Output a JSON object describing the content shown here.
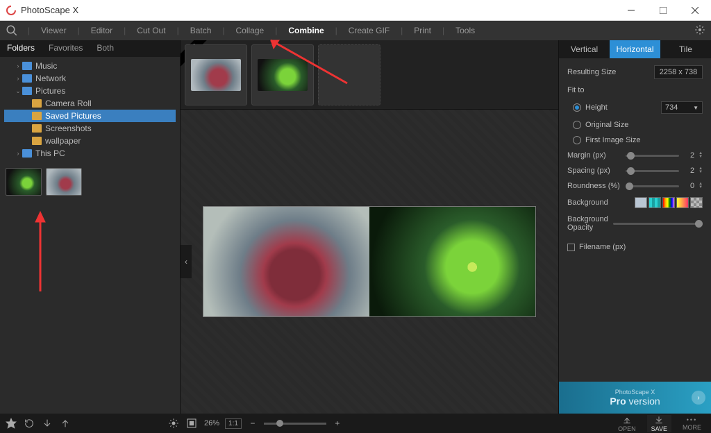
{
  "titlebar": {
    "app_name": "PhotoScape X"
  },
  "nav": {
    "items": [
      "Viewer",
      "Editor",
      "Cut Out",
      "Batch",
      "Collage",
      "Combine",
      "Create GIF",
      "Print",
      "Tools"
    ],
    "active_index": 5
  },
  "folder_tabs": {
    "items": [
      "Folders",
      "Favorites",
      "Both"
    ],
    "active_index": 0
  },
  "tree": {
    "rows": [
      {
        "label": "Music",
        "indent": 1,
        "icon": "drive",
        "arrow": "›"
      },
      {
        "label": "Network",
        "indent": 1,
        "icon": "drive",
        "arrow": "›"
      },
      {
        "label": "Pictures",
        "indent": 1,
        "icon": "drive",
        "arrow": "⌄"
      },
      {
        "label": "Camera Roll",
        "indent": 2,
        "icon": "folder",
        "arrow": ""
      },
      {
        "label": "Saved Pictures",
        "indent": 2,
        "icon": "folder",
        "arrow": "",
        "selected": true
      },
      {
        "label": "Screenshots",
        "indent": 2,
        "icon": "folder",
        "arrow": ""
      },
      {
        "label": "wallpaper",
        "indent": 2,
        "icon": "folder",
        "arrow": ""
      },
      {
        "label": "This PC",
        "indent": 1,
        "icon": "drive",
        "arrow": "›"
      }
    ]
  },
  "orient_tabs": {
    "items": [
      "Vertical",
      "Horizontal",
      "Tile"
    ],
    "active_index": 1
  },
  "panel": {
    "resulting_size_label": "Resulting Size",
    "resulting_size_value": "2258 x 738",
    "fit_to_label": "Fit to",
    "fit_to_options": [
      {
        "label": "Height",
        "checked": true,
        "value": "734"
      },
      {
        "label": "Original Size",
        "checked": false
      },
      {
        "label": "First Image Size",
        "checked": false
      }
    ],
    "margin_label": "Margin (px)",
    "margin_value": "2",
    "spacing_label": "Spacing (px)",
    "spacing_value": "2",
    "roundness_label": "Roundness (%)",
    "roundness_value": "0",
    "background_label": "Background",
    "bg_opacity_label": "Background Opacity",
    "filename_label": "Filename (px)"
  },
  "promo": {
    "small": "PhotoScape X",
    "big": "Pro version"
  },
  "bottom": {
    "zoom_pct": "26%",
    "zoom_ratio": "1:1",
    "open_label": "OPEN",
    "save_label": "SAVE",
    "more_label": "MORE"
  }
}
